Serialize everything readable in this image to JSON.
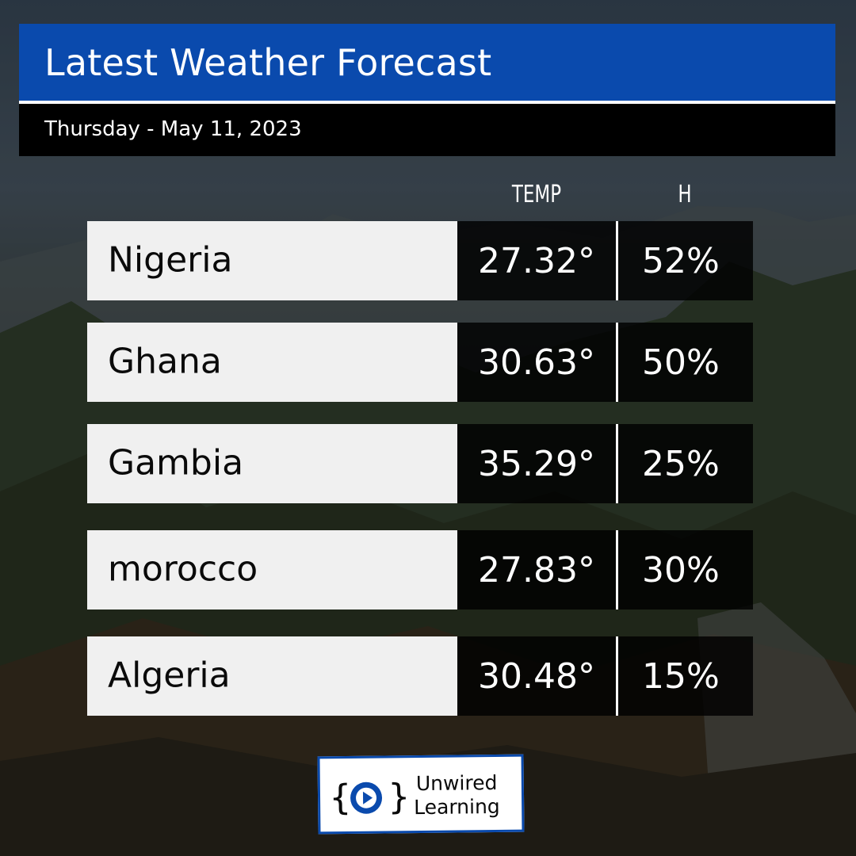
{
  "header": {
    "title": "Latest Weather Forecast",
    "date": "Thursday - May 11, 2023"
  },
  "columns": {
    "temp": "TEMP",
    "humidity": "H"
  },
  "rows": [
    {
      "country": "Nigeria",
      "temp": "27.32°",
      "humidity": "52%"
    },
    {
      "country": "Ghana",
      "temp": "30.63°",
      "humidity": "50%"
    },
    {
      "country": "Gambia",
      "temp": "35.29°",
      "humidity": "25%"
    },
    {
      "country": "morocco",
      "temp": "27.83°",
      "humidity": "30%"
    },
    {
      "country": "Algeria",
      "temp": "30.48°",
      "humidity": "15%"
    }
  ],
  "logo": {
    "line1": "Unwired",
    "line2": "Learning",
    "icon": "play-icon"
  },
  "colors": {
    "brand_blue": "#0a4aad",
    "row_light": "#f0f0f0",
    "cell_dark": "#000000"
  }
}
